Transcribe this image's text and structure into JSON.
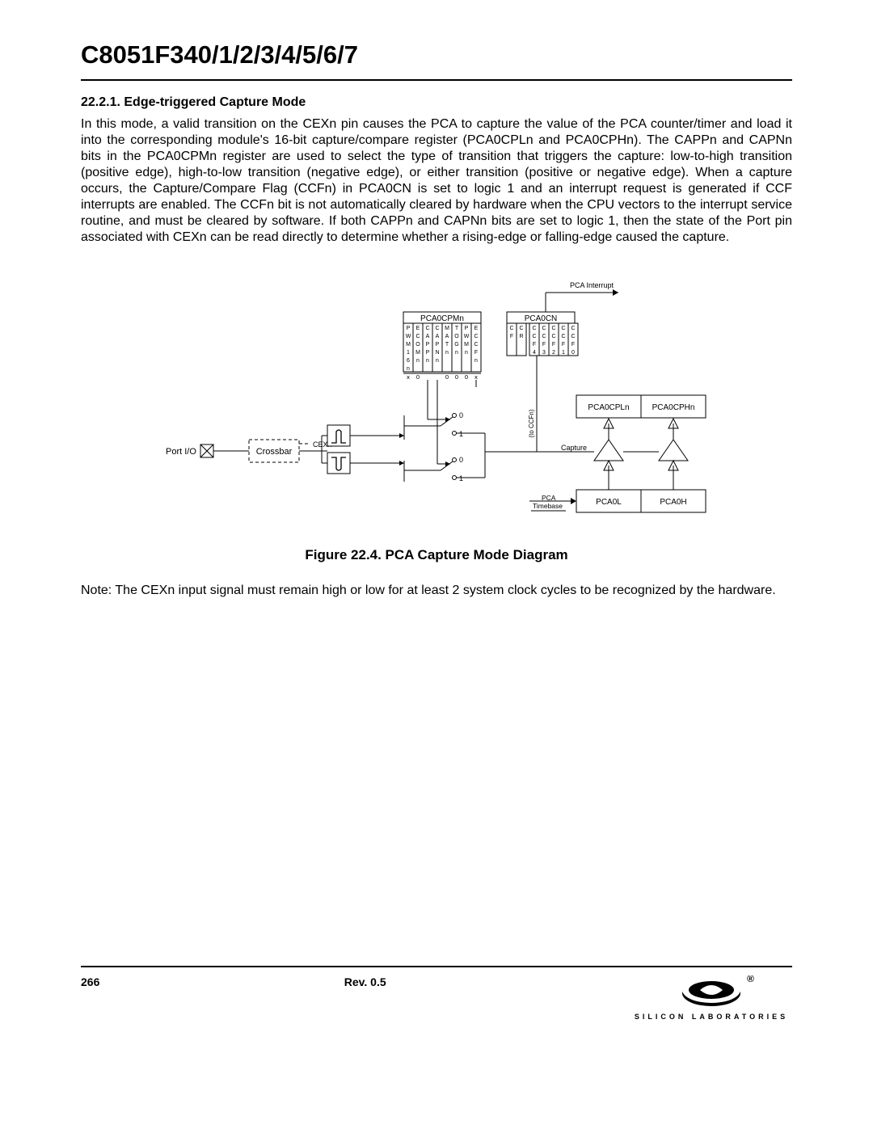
{
  "header": {
    "title": "C8051F340/1/2/3/4/5/6/7"
  },
  "section": {
    "heading": "22.2.1. Edge-triggered Capture Mode",
    "body": "In this mode, a valid transition on the CEXn pin causes the PCA to capture the value of the PCA counter/timer and load it into the corresponding module's 16-bit capture/compare register (PCA0CPLn and PCA0CPHn). The CAPPn and CAPNn bits in the PCA0CPMn register are used to select the type of transition that triggers the capture: low-to-high transition (positive edge), high-to-low transition (negative edge), or either transition (positive or negative edge). When a capture occurs, the Capture/Compare Flag (CCFn) in PCA0CN is set to logic 1 and an interrupt request is generated if CCF interrupts are enabled. The CCFn bit is not automatically cleared by hardware when the CPU vectors to the interrupt service routine, and must be cleared by software. If both CAPPn and CAPNn bits are set to logic 1, then the state of the Port pin associated with CEXn can be read directly to determine whether a rising-edge or falling-edge caused the capture."
  },
  "figure": {
    "caption": "Figure 22.4. PCA Capture Mode Diagram",
    "labels": {
      "pca_interrupt": "PCA Interrupt",
      "pca0cpmn": "PCA0CPMn",
      "pca0cn": "PCA0CN",
      "port_io": "Port I/O",
      "crossbar": "Crossbar",
      "cexn": "CEXn",
      "pca_timebase": "PCA Timebase",
      "capture": "Capture",
      "to_ccfn": "(to CCFn)",
      "pca0cpln": "PCA0CPLn",
      "pca0cphn": "PCA0CPHn",
      "pca0l": "PCA0L",
      "pca0h": "PCA0H"
    },
    "pca0cpmn_cols": [
      [
        "P",
        "W",
        "M",
        "1",
        "6",
        "n"
      ],
      [
        "E",
        "C",
        "O",
        "M",
        "n",
        ""
      ],
      [
        "C",
        "A",
        "P",
        "P",
        "n",
        ""
      ],
      [
        "C",
        "A",
        "P",
        "N",
        "n",
        ""
      ],
      [
        "M",
        "A",
        "T",
        "n",
        "",
        ""
      ],
      [
        "T",
        "O",
        "G",
        "n",
        "",
        ""
      ],
      [
        "P",
        "W",
        "M",
        "n",
        "",
        ""
      ],
      [
        "E",
        "C",
        "C",
        "F",
        "n",
        ""
      ]
    ],
    "pca0cpmn_footer": [
      "x",
      "0",
      "",
      "",
      "0",
      "0",
      "0",
      "x"
    ],
    "pca0cn_cols": [
      [
        "C",
        "F"
      ],
      [
        "C",
        "R"
      ],
      [
        "C",
        "C",
        "F",
        "4"
      ],
      [
        "C",
        "C",
        "F",
        "3"
      ],
      [
        "C",
        "C",
        "F",
        "2"
      ],
      [
        "C",
        "C",
        "F",
        "1"
      ],
      [
        "C",
        "C",
        "F",
        "0"
      ]
    ],
    "switch_labels": [
      "0",
      "1",
      "0",
      "1"
    ]
  },
  "note": "Note: The CEXn input signal must remain high or low for at least 2 system clock cycles to be recognized by the hardware.",
  "footer": {
    "page": "266",
    "rev": "Rev. 0.5",
    "company": "SILICON LABORATORIES"
  }
}
